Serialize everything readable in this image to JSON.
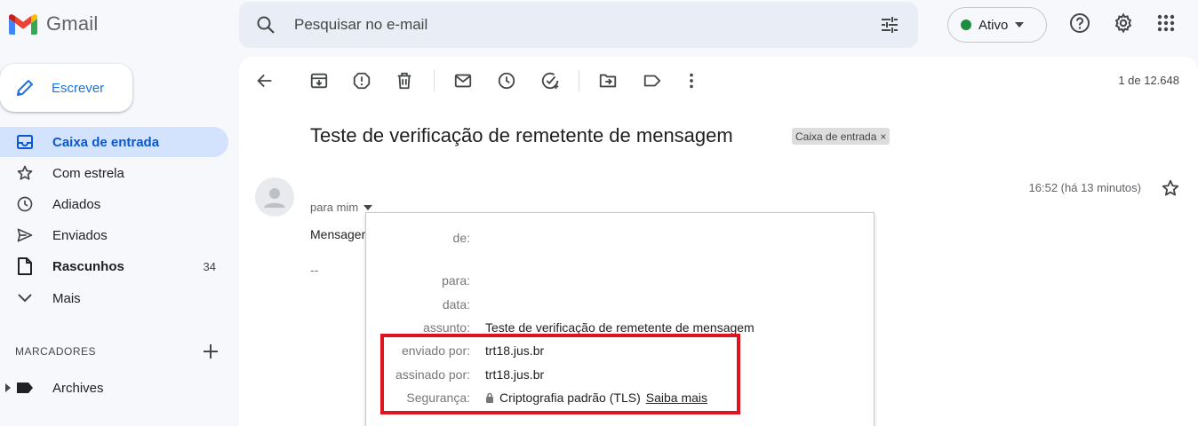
{
  "app": {
    "name": "Gmail"
  },
  "search": {
    "placeholder": "Pesquisar no e-mail"
  },
  "status": {
    "label": "Ativo",
    "color": "#1e8e3e"
  },
  "compose": {
    "label": "Escrever"
  },
  "sidebar": {
    "items": [
      {
        "label": "Caixa de entrada",
        "icon": "inbox-icon",
        "active": true
      },
      {
        "label": "Com estrela",
        "icon": "star-outline-icon"
      },
      {
        "label": "Adiados",
        "icon": "clock-icon"
      },
      {
        "label": "Enviados",
        "icon": "send-icon"
      },
      {
        "label": "Rascunhos",
        "icon": "draft-icon",
        "count": "34"
      },
      {
        "label": "Mais",
        "icon": "chevron-down-icon"
      }
    ],
    "labels_title": "MARCADORES",
    "labels": [
      {
        "label": "Archives",
        "icon": "label-icon"
      }
    ]
  },
  "toolbar": {
    "pager": "1 de 12.648",
    "icons": [
      "back-arrow-icon",
      "archive-icon",
      "report-spam-icon",
      "delete-icon",
      "mark-unread-icon",
      "snooze-icon",
      "add-task-icon",
      "move-to-icon",
      "label-icon",
      "more-vert-icon"
    ]
  },
  "message": {
    "subject": "Teste de verificação de remetente de mensagem",
    "badge": "Caixa de entrada",
    "badge_close": "×",
    "time": "16:52 (há 13 minutos)",
    "to": "para mim",
    "body": "Mensagem",
    "signature": "--"
  },
  "details": {
    "rows": [
      {
        "label": "de:",
        "value": ""
      },
      {
        "label": "para:",
        "value": ""
      },
      {
        "label": "data:",
        "value": ""
      },
      {
        "label": "assunto:",
        "value": "Teste de verificação de remetente de mensagem"
      },
      {
        "label": "enviado por:",
        "value": "trt18.jus.br"
      },
      {
        "label": "assinado por:",
        "value": "trt18.jus.br"
      },
      {
        "label": "Segurança:",
        "value": "Criptografia padrão (TLS)",
        "link": "Saiba mais"
      }
    ]
  },
  "colors": {
    "accent": "#0b57d0",
    "highlight": "#e0141e",
    "active_bg": "#d3e3fd"
  }
}
